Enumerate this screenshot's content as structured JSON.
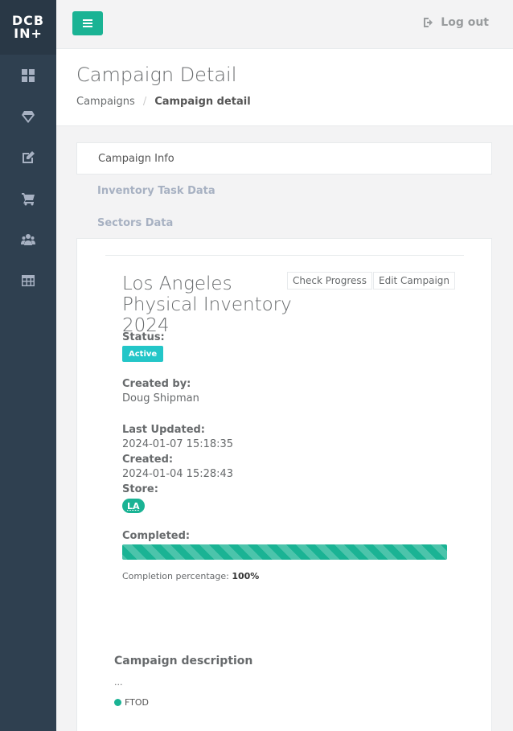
{
  "brand": {
    "line1": "DCB",
    "line2": "IN+"
  },
  "sidebar": {
    "items": [
      {
        "icon": "dashboard-icon"
      },
      {
        "icon": "diamond-icon"
      },
      {
        "icon": "edit-icon"
      },
      {
        "icon": "cart-icon"
      },
      {
        "icon": "users-icon"
      },
      {
        "icon": "table-icon"
      }
    ]
  },
  "topbar": {
    "logout_label": "Log out"
  },
  "heading": {
    "title": "Campaign Detail",
    "breadcrumb": {
      "parent": "Campaigns",
      "separator": "/",
      "current": "Campaign detail"
    }
  },
  "tabs": [
    "Campaign Info",
    "Inventory Task Data",
    "Sectors Data"
  ],
  "campaign": {
    "title_line1": "Los Angeles",
    "title_line2": "Physical Inventory 2024",
    "check_progress_label": "Check Progress",
    "edit_campaign_label": "Edit Campaign",
    "status_label": "Status:",
    "status_value": "Active",
    "created_by_label": "Created by:",
    "created_by_value": "Doug Shipman",
    "last_updated_label": "Last Updated:",
    "last_updated_value": "2024-01-07 15:18:35",
    "created_label": "Created:",
    "created_value": "2024-01-04 15:28:43",
    "store_label": "Store:",
    "store_value": "LA",
    "completed_label": "Completed:",
    "completion_prefix": "Completion percentage:",
    "completion_value": "100%",
    "completion_fraction": 1.0
  },
  "description": {
    "title": "Campaign description",
    "text": "...",
    "tag": "FTOD"
  },
  "colors": {
    "sidebar": "#2f4050",
    "accent": "#1ab394",
    "info": "#23c6c8"
  }
}
